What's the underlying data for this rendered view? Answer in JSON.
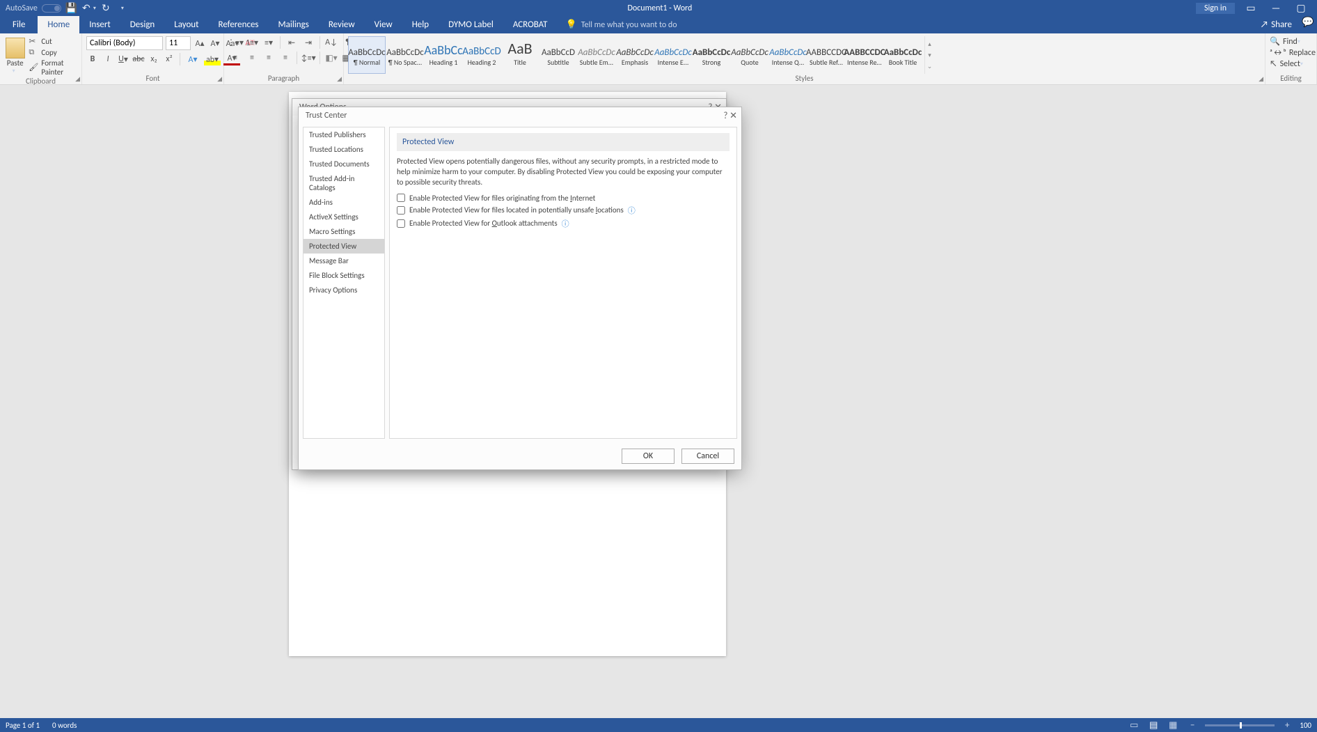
{
  "titlebar": {
    "autosave_label": "AutoSave",
    "doc_title": "Document1 - Word",
    "signin": "Sign in"
  },
  "tabs": {
    "file": "File",
    "home": "Home",
    "insert": "Insert",
    "design": "Design",
    "layout": "Layout",
    "references": "References",
    "mailings": "Mailings",
    "review": "Review",
    "view": "View",
    "help": "Help",
    "dymo": "DYMO Label",
    "acrobat": "ACROBAT",
    "tellme": "Tell me what you want to do",
    "share": "Share"
  },
  "ribbon": {
    "clipboard": {
      "label": "Clipboard",
      "paste": "Paste",
      "cut": "Cut",
      "copy": "Copy",
      "format_painter": "Format Painter"
    },
    "font": {
      "label": "Font",
      "name": "Calibri (Body)",
      "size": "11"
    },
    "paragraph": {
      "label": "Paragraph"
    },
    "styles": {
      "label": "Styles",
      "items": [
        {
          "preview": "AaBbCcDc",
          "caption": "¶ Normal",
          "cls": ""
        },
        {
          "preview": "AaBbCcDc",
          "caption": "¶ No Spac...",
          "cls": ""
        },
        {
          "preview": "AaBbCc",
          "caption": "Heading 1",
          "cls": "h1"
        },
        {
          "preview": "AaBbCcD",
          "caption": "Heading 2",
          "cls": "h2"
        },
        {
          "preview": "AaB",
          "caption": "Title",
          "cls": "title"
        },
        {
          "preview": "AaBbCcD",
          "caption": "Subtitle",
          "cls": ""
        },
        {
          "preview": "AaBbCcDc",
          "caption": "Subtle Em...",
          "cls": "subtle"
        },
        {
          "preview": "AaBbCcDc",
          "caption": "Emphasis",
          "cls": "emph"
        },
        {
          "preview": "AaBbCcDc",
          "caption": "Intense E...",
          "cls": "intE"
        },
        {
          "preview": "AaBbCcDc",
          "caption": "Strong",
          "cls": "strong"
        },
        {
          "preview": "AaBbCcDc",
          "caption": "Quote",
          "cls": "quote"
        },
        {
          "preview": "AaBbCcDc",
          "caption": "Intense Q...",
          "cls": "intQ"
        },
        {
          "preview": "AABBCCDC",
          "caption": "Subtle Ref...",
          "cls": "ref"
        },
        {
          "preview": "AABBCCDC",
          "caption": "Intense Re...",
          "cls": "iref"
        },
        {
          "preview": "AaBbCcDc",
          "caption": "Book Title",
          "cls": "bt"
        }
      ]
    },
    "editing": {
      "label": "Editing",
      "find": "Find",
      "replace": "Replace",
      "select": "Select"
    }
  },
  "dialogs": {
    "options_title": "Word Options",
    "trust": {
      "title": "Trust Center",
      "nav": [
        "Trusted Publishers",
        "Trusted Locations",
        "Trusted Documents",
        "Trusted Add-in Catalogs",
        "Add-ins",
        "ActiveX Settings",
        "Macro Settings",
        "Protected View",
        "Message Bar",
        "File Block Settings",
        "Privacy Options"
      ],
      "heading": "Protected View",
      "desc": "Protected View opens potentially dangerous files, without any security prompts, in a restricted mode to help minimize harm to your computer. By disabling Protected View you could be exposing your computer to possible security threats.",
      "chk1_pre": "Enable Protected View for files originating from the ",
      "chk1_u": "I",
      "chk1_post": "nternet",
      "chk2_pre": "Enable Protected View for files located in potentially unsafe ",
      "chk2_u": "l",
      "chk2_post": "ocations",
      "chk3_pre": "Enable Protected View for ",
      "chk3_u": "O",
      "chk3_post": "utlook attachments",
      "ok": "OK",
      "cancel": "Cancel"
    }
  },
  "statusbar": {
    "page": "Page 1 of 1",
    "words": "0 words",
    "zoom": "100"
  }
}
